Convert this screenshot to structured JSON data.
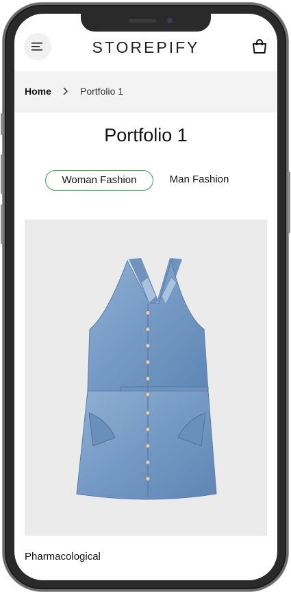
{
  "brand": {
    "logo": "STOREPIFY"
  },
  "breadcrumb": {
    "home": "Home",
    "current": "Portfolio 1"
  },
  "page": {
    "title": "Portfolio 1"
  },
  "tabs": [
    {
      "label": "Woman Fashion",
      "active": true
    },
    {
      "label": "Man Fashion",
      "active": false
    }
  ],
  "product": {
    "name": "Pharmacological"
  },
  "colors": {
    "active_tab_border": "#3aa05a",
    "breadcrumb_bg": "#f3f3f3",
    "image_bg": "#ebebeb"
  },
  "icons": [
    "menu-icon",
    "cart-icon",
    "chevron-right-icon"
  ]
}
